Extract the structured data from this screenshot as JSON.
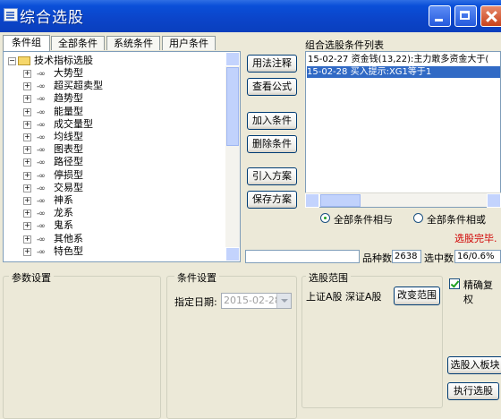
{
  "window": {
    "title": "综合选股"
  },
  "tabs": [
    "条件组",
    "全部条件",
    "系统条件",
    "用户条件"
  ],
  "tree": {
    "root": "技术指标选股",
    "items": [
      "大势型",
      "超买超卖型",
      "趋势型",
      "能量型",
      "成交量型",
      "均线型",
      "图表型",
      "路径型",
      "停损型",
      "交易型",
      "神系",
      "龙系",
      "鬼系",
      "其他系",
      "特色型"
    ]
  },
  "buttons": {
    "usage": "用法注释",
    "formula": "查看公式",
    "add": "加入条件",
    "delete": "删除条件",
    "import": "引入方案",
    "save": "保存方案",
    "change_range": "改变范围",
    "to_block": "选股入板块",
    "execute": "执行选股"
  },
  "condition_list": {
    "label": "组合选股条件列表",
    "rows": [
      "15-02-27 资金钱(13,22):主力敢多资金大于(",
      "15-02-28 买入提示:XG1等于1"
    ],
    "selected_index": 1
  },
  "logic": {
    "and_label": "全部条件相与",
    "or_label": "全部条件相或",
    "selected": "and"
  },
  "status": {
    "done": "选股完毕.",
    "count_label": "品种数",
    "count_value": "2638",
    "selected_label": "选中数",
    "selected_value": "16/0.6%"
  },
  "params": {
    "title": "参数设置"
  },
  "condition_settings": {
    "title": "条件设置",
    "date_label": "指定日期:",
    "date_value": "2015-02-28"
  },
  "range": {
    "title": "选股范围",
    "text": "上证A股 深证A股"
  },
  "exact_rights": {
    "label": "精确复权",
    "checked": true
  }
}
